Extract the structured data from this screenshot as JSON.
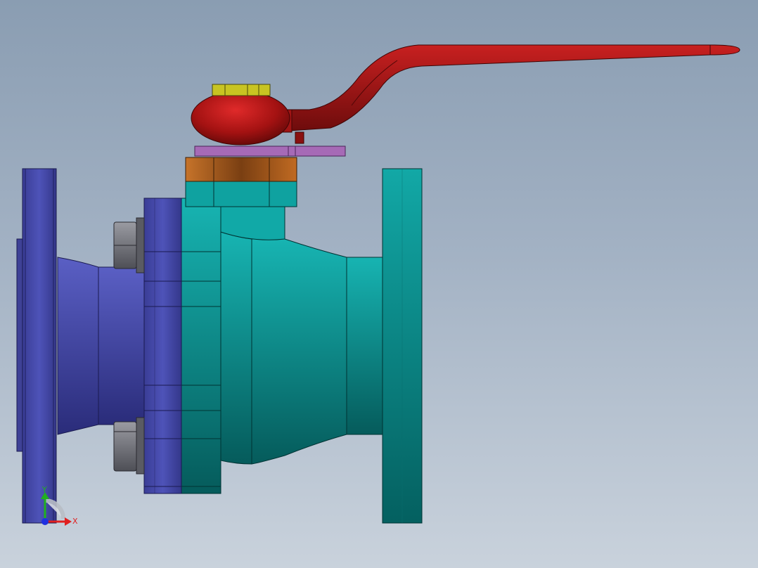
{
  "triad": {
    "y_label": "Y",
    "x_label": "X"
  },
  "colors": {
    "background_top": "#8a9db2",
    "background_bottom": "#c9d2dc",
    "left_flange": "#4a4fa8",
    "body_teal": "#0e8b8b",
    "handle_red": "#8e1515",
    "stem_nut_yellow": "#c8c422",
    "packing_orange": "#b5651d",
    "gland_purple": "#a56bb4",
    "bolt_gray": "#6f7078",
    "axis_x": "#e02020",
    "axis_y": "#20b020",
    "axis_z": "#2030e0"
  }
}
